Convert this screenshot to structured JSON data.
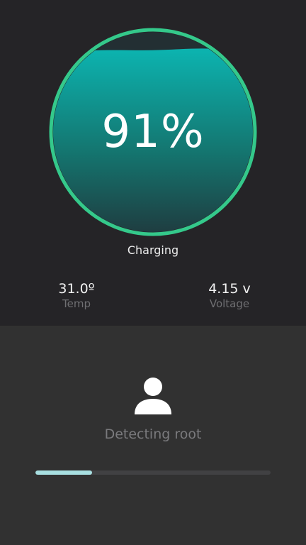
{
  "battery": {
    "percent_text": "91%",
    "status": "Charging",
    "level": 0.91
  },
  "stats": {
    "temp": {
      "value": "31.0º",
      "label": "Temp"
    },
    "voltage": {
      "value": "4.15 v",
      "label": "Voltage"
    }
  },
  "root_check": {
    "icon": "user-icon",
    "label": "Detecting root",
    "progress": 0.24
  },
  "colors": {
    "ring": "#34c98b",
    "fill_top": "#0cb4b0",
    "fill_bottom": "#1f3a3e",
    "progress": "#a8dfe1",
    "background_top": "#252427",
    "background_bottom": "#313131"
  }
}
